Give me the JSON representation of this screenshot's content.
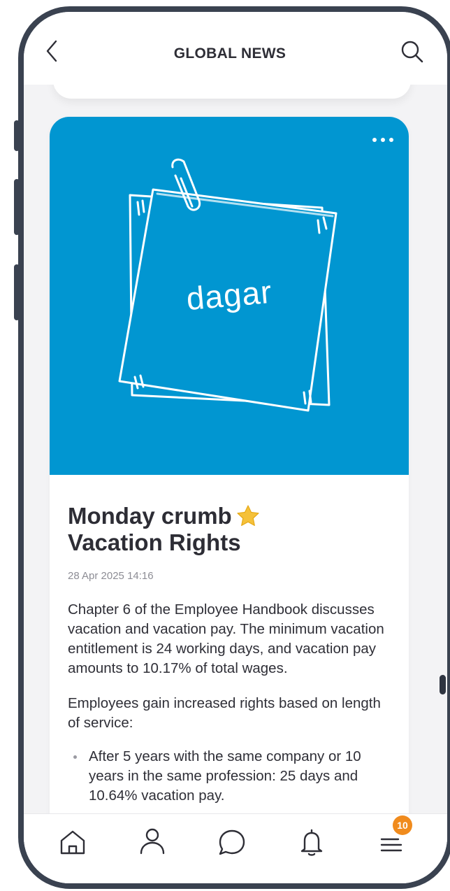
{
  "header": {
    "title": "GLOBAL NEWS",
    "back_icon": "chevron-left-icon",
    "search_icon": "search-icon"
  },
  "article": {
    "image": {
      "brand_text": "dagar",
      "background_color": "#0196d1",
      "more_icon": "more-horizontal-icon"
    },
    "title_line1": "Monday crumb",
    "title_line2": "Vacation Rights",
    "title_emoji": "star-icon",
    "date": "28 Apr 2025 14:16",
    "paragraphs": [
      "Chapter 6 of the Employee Handbook discusses vacation and vacation pay. The minimum vacation entitlement is 24 working days, and vacation pay amounts to 10.17% of total wages.",
      "Employees gain increased rights based on length of service:"
    ],
    "bullets": [
      "After 5 years with the same company or 10 years in the same profession: 25 days and 10.64% vacation pay."
    ]
  },
  "tabbar": {
    "items": [
      {
        "icon": "home-icon"
      },
      {
        "icon": "profile-icon"
      },
      {
        "icon": "chat-icon"
      },
      {
        "icon": "bell-icon"
      },
      {
        "icon": "menu-icon",
        "badge": "10"
      }
    ],
    "badge_color": "#f08b1d"
  }
}
